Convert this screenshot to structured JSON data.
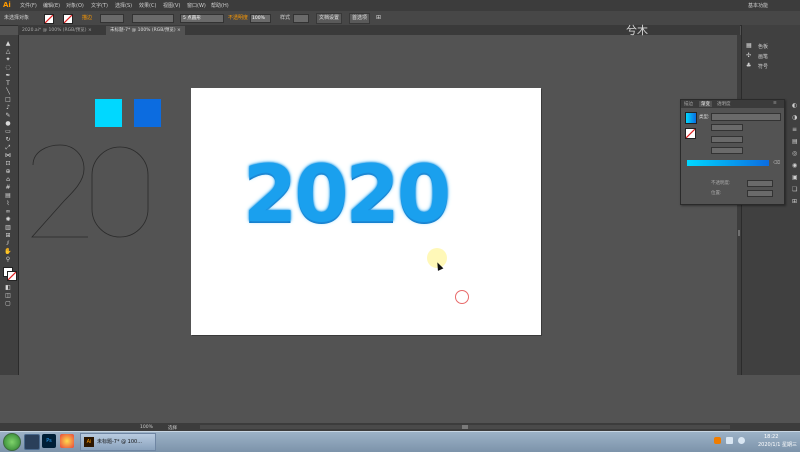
{
  "app": {
    "logo": "Ai"
  },
  "menubar": {
    "items": [
      "文件(F)",
      "编辑(E)",
      "对象(O)",
      "文字(T)",
      "选择(S)",
      "效果(C)",
      "视图(V)",
      "窗口(W)",
      "帮助(H)"
    ],
    "workspace": "基本功能"
  },
  "controlbar": {
    "selection_label": "未选择对象",
    "stroke_label": "描边",
    "brush_value": "5 点圆形",
    "opacity_label": "不透明度",
    "opacity_value": "100%",
    "style_label": "样式",
    "doc_setup_button": "文档设置",
    "preferences_button": "首选项"
  },
  "tabs": [
    {
      "label": "2020.ai* @ 100% (RGB/预览)"
    },
    {
      "label": "未标题-7* @ 100% (RGB/预览)"
    }
  ],
  "canvas": {
    "artwork_text": "2020",
    "outline_text": "20"
  },
  "colors": {
    "swatch_cyan": "#00d8ff",
    "swatch_blue": "#0c6ce0",
    "accent_logo": "#ff9a00",
    "art_main": "#1aa0ee"
  },
  "dock": {
    "items": [
      {
        "icon": "swatches-icon",
        "label": "色板"
      },
      {
        "icon": "brushes-icon",
        "label": "画笔"
      },
      {
        "icon": "symbols-icon",
        "label": "符号"
      }
    ]
  },
  "gradient_panel": {
    "tabs": [
      "描边",
      "渐变",
      "透明度"
    ],
    "type_label": "类型:",
    "opacity_label": "不透明度:",
    "location_label": "位置:"
  },
  "watermark": "兮木",
  "statusbar": {
    "zoom": "100%",
    "tool": "选择"
  },
  "taskbar": {
    "ai_window": "未标题-7* @ 100...",
    "time": "18:22",
    "date": "2020/1/1 星期三"
  }
}
